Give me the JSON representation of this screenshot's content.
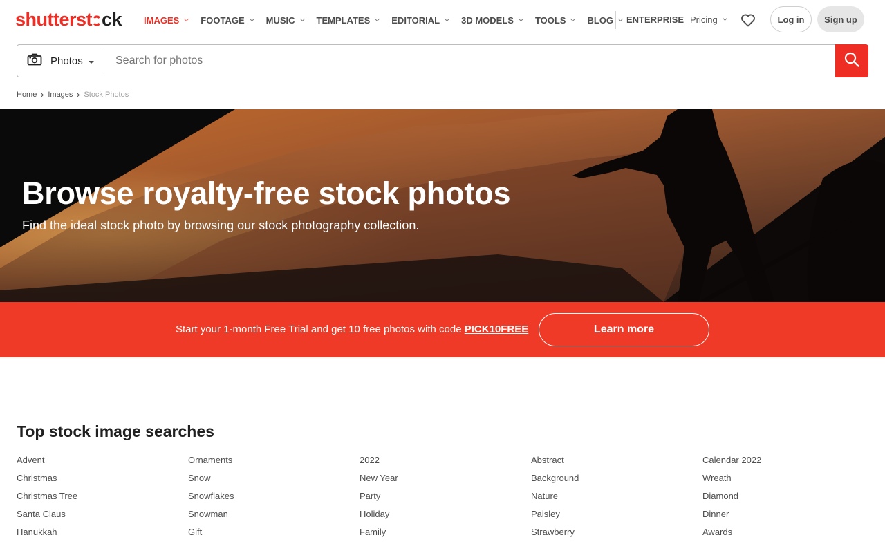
{
  "header": {
    "logo": {
      "part1": "shutterst",
      "part2": "ck"
    },
    "nav": [
      {
        "label": "IMAGES",
        "active": true
      },
      {
        "label": "FOOTAGE"
      },
      {
        "label": "MUSIC"
      },
      {
        "label": "TEMPLATES"
      },
      {
        "label": "EDITORIAL"
      },
      {
        "label": "3D MODELS"
      },
      {
        "label": "TOOLS"
      },
      {
        "label": "BLOG"
      }
    ],
    "enterprise": "ENTERPRISE",
    "pricing": "Pricing",
    "login": "Log in",
    "signup": "Sign up"
  },
  "search": {
    "type": "Photos",
    "placeholder": "Search for photos"
  },
  "breadcrumb": [
    "Home",
    "Images",
    "Stock Photos"
  ],
  "hero": {
    "title": "Browse royalty-free stock photos",
    "subtitle": "Find the ideal stock photo by browsing our stock photography collection."
  },
  "promo": {
    "text": "Start your 1-month Free Trial and get 10 free photos with code ",
    "code": "PICK10FREE",
    "button": "Learn more"
  },
  "top_searches": {
    "title": "Top stock image searches",
    "columns": [
      [
        "Advent",
        "Christmas",
        "Christmas Tree",
        "Santa Claus",
        "Hanukkah"
      ],
      [
        "Ornaments",
        "Snow",
        "Snowflakes",
        "Snowman",
        "Gift"
      ],
      [
        "2022",
        "New Year",
        "Party",
        "Holiday",
        "Family"
      ],
      [
        "Abstract",
        "Background",
        "Nature",
        "Paisley",
        "Strawberry"
      ],
      [
        "Calendar 2022",
        "Wreath",
        "Diamond",
        "Dinner",
        "Awards"
      ]
    ]
  },
  "colors": {
    "brand_red": "#ee2e24",
    "promo_red": "#ee3a26",
    "text_dark": "#212121",
    "text_muted": "#4d4d4d"
  }
}
